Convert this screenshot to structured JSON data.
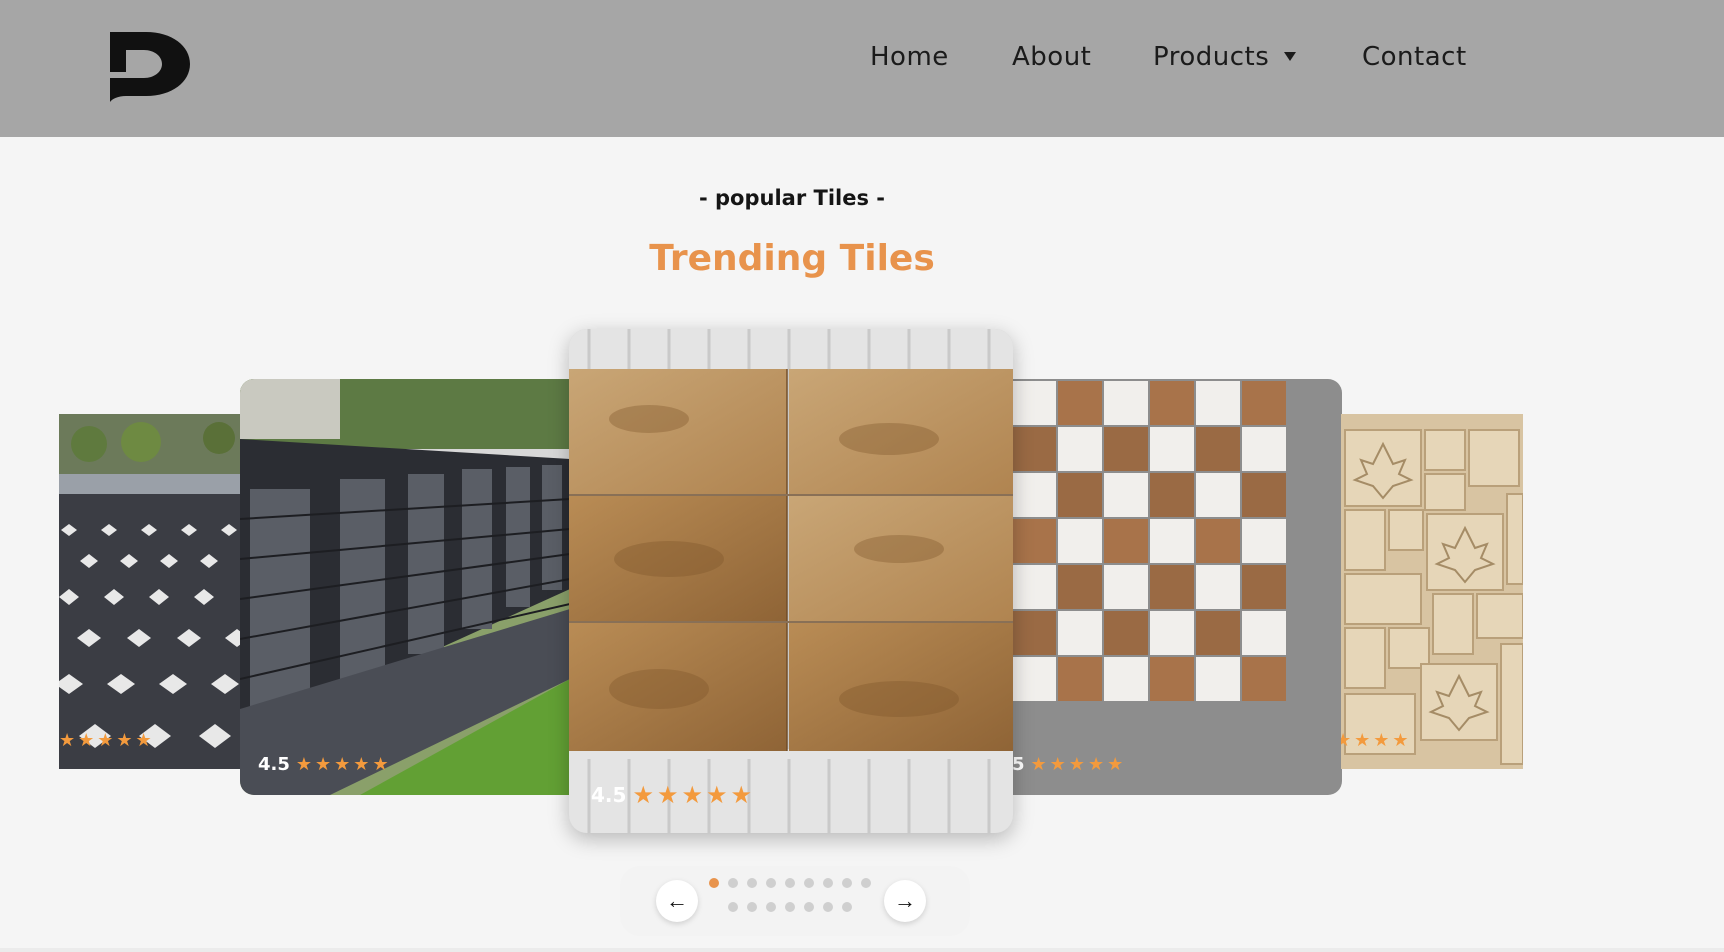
{
  "header": {
    "logo_alt": "D",
    "nav": [
      {
        "label": "Home"
      },
      {
        "label": "About"
      },
      {
        "label": "Products",
        "icon": "caret-down-icon"
      },
      {
        "label": "Contact"
      }
    ]
  },
  "section": {
    "subtitle": "- popular Tiles -",
    "title": "Trending Tiles"
  },
  "carousel": {
    "cards": [
      {
        "name": "paving-tiles",
        "rating": "",
        "stars": "★★★★★"
      },
      {
        "name": "brick-wall-tiles",
        "rating": "4.5",
        "stars": "★★★★★"
      },
      {
        "name": "sandstone-tiles",
        "rating": "4.5",
        "stars": "★★★★★"
      },
      {
        "name": "checker-stone-tiles",
        "rating": "5",
        "stars": "★★★★★"
      },
      {
        "name": "leaf-carved-tiles",
        "rating": "",
        "stars": "★★★★"
      }
    ],
    "prev_icon": "arrow-left-icon",
    "next_icon": "arrow-right-icon",
    "prev_label": "←",
    "next_label": "→",
    "active_dot": 0,
    "dot_rows": [
      9,
      7
    ]
  },
  "colors": {
    "header_bg": "#a6a6a6",
    "accent": "#e8934c",
    "star": "#f39a3d",
    "page_bg": "#f5f5f5"
  }
}
